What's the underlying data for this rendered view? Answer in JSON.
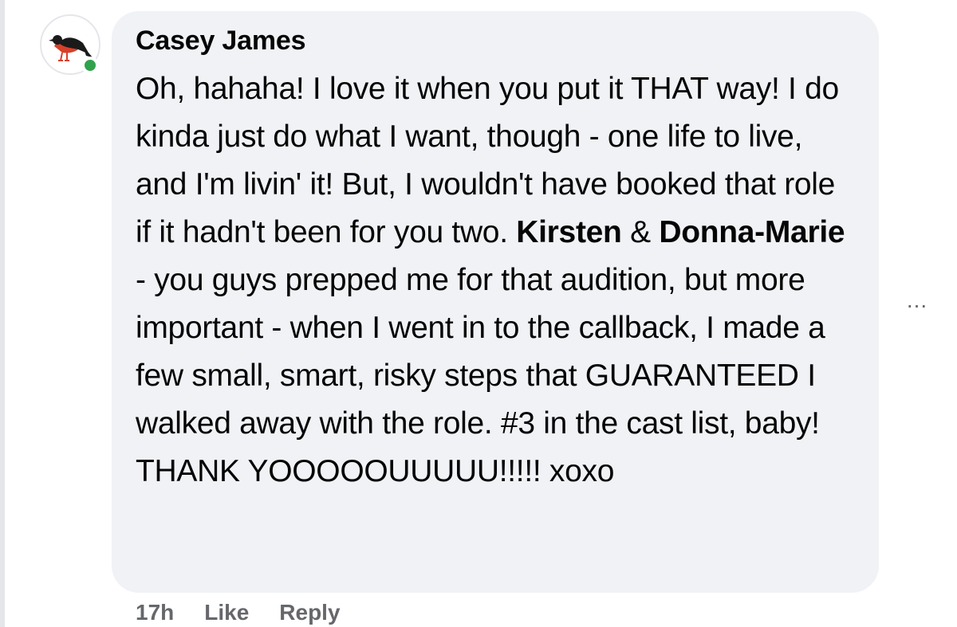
{
  "comment": {
    "author": "Casey James",
    "segments": [
      {
        "text": "Oh, hahaha! I love it when you put it THAT way! I do kinda just do what I want, though - one life to live, and I'm livin' it! But, I wouldn't have booked that role if it hadn't been for you two. "
      },
      {
        "text": "Kirsten",
        "mention": true
      },
      {
        "text": " & "
      },
      {
        "text": "Donna-Marie",
        "mention": true
      },
      {
        "text": " - you guys prepped me for that audition, but more important - when I went in to the callback, I made a few small, smart, risky steps that GUARANTEED I walked away with the role. #3 in the cast list, baby! THANK YOOOOOUUUUU!!!!! xoxo"
      }
    ]
  },
  "actions": {
    "timestamp": "17h",
    "like_label": "Like",
    "reply_label": "Reply"
  },
  "more_menu_label": "...",
  "icons": {
    "avatar": "crow-avatar-icon",
    "status": "online-status-dot",
    "more": "more-options-icon"
  },
  "colors": {
    "bubble": "#f0f2f5",
    "online": "#31a24c",
    "secondary_text": "#65676b"
  }
}
